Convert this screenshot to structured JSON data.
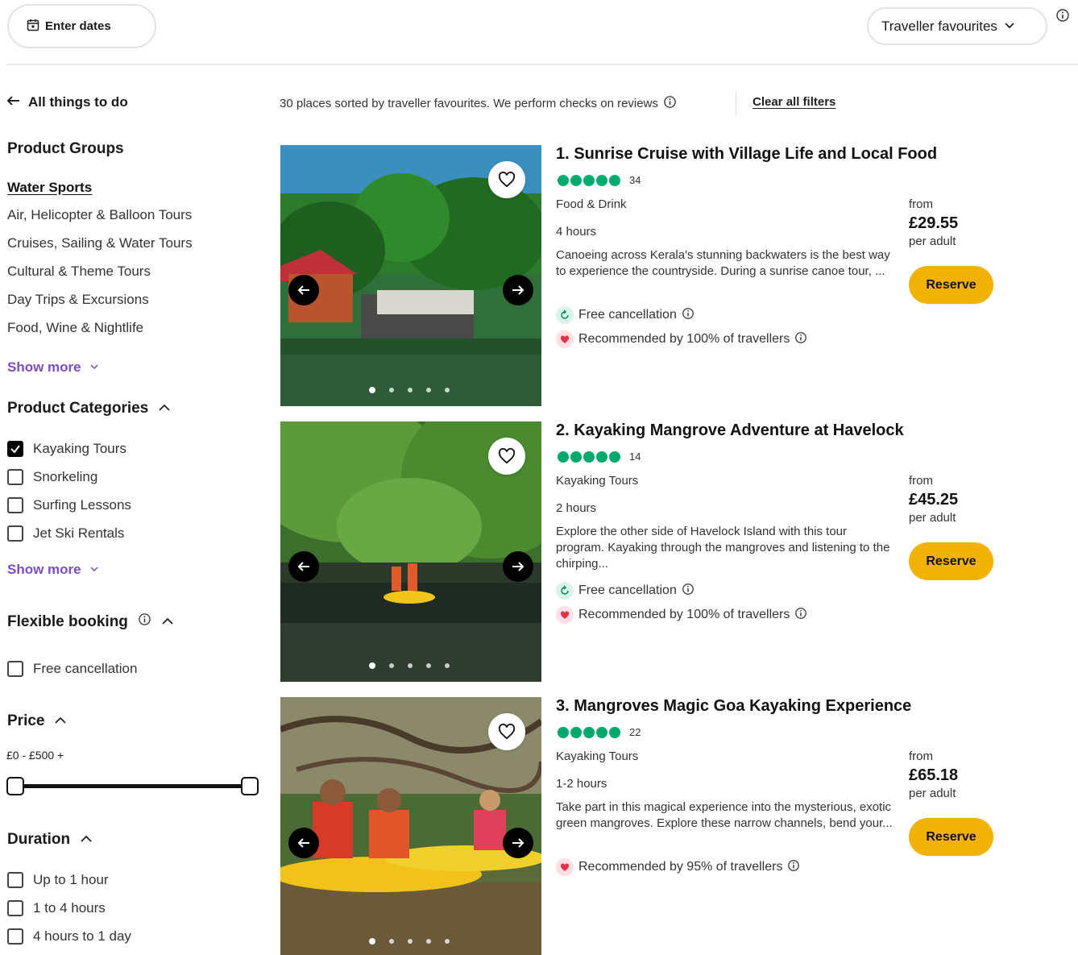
{
  "toolbar": {
    "dates_label": "Enter dates",
    "sort_label": "Traveller favourites"
  },
  "sidebar": {
    "back_label": "All things to do",
    "product_groups": {
      "heading": "Product Groups",
      "items": [
        {
          "label": "Water Sports",
          "active": true
        },
        {
          "label": "Air, Helicopter & Balloon Tours"
        },
        {
          "label": "Cruises, Sailing & Water Tours"
        },
        {
          "label": "Cultural & Theme Tours"
        },
        {
          "label": "Day Trips & Excursions"
        },
        {
          "label": "Food, Wine & Nightlife"
        }
      ],
      "show_more": "Show more"
    },
    "product_categories": {
      "heading": "Product Categories",
      "items": [
        {
          "label": "Kayaking Tours",
          "checked": true
        },
        {
          "label": "Snorkeling",
          "checked": false
        },
        {
          "label": "Surfing Lessons",
          "checked": false
        },
        {
          "label": "Jet Ski Rentals",
          "checked": false
        }
      ],
      "show_more": "Show more"
    },
    "flexible_booking": {
      "heading": "Flexible booking",
      "items": [
        {
          "label": "Free cancellation",
          "checked": false
        }
      ]
    },
    "price": {
      "heading": "Price",
      "range": "£0 - £500 +"
    },
    "duration": {
      "heading": "Duration",
      "items": [
        {
          "label": "Up to 1 hour",
          "checked": false
        },
        {
          "label": "1 to 4 hours",
          "checked": false
        },
        {
          "label": "4 hours to 1 day",
          "checked": false
        }
      ]
    }
  },
  "results": {
    "summary": "30 places sorted by traveller favourites. We perform checks on reviews",
    "clear_filters": "Clear all filters",
    "cards": [
      {
        "title": "1. Sunrise Cruise with Village Life and Local Food",
        "rating_count": "34",
        "rating_bubbles": 5,
        "category": "Food & Drink",
        "duration": "4 hours",
        "description": "Canoeing across Kerala's stunning backwaters is the best way to experience the countryside. During a sunrise canoe tour, ...",
        "free_cancellation": "Free cancellation",
        "recommended": "Recommended by 100% of travellers",
        "from": "from",
        "price": "£29.55",
        "per": "per adult",
        "reserve": "Reserve"
      },
      {
        "title": "2. Kayaking Mangrove Adventure at Havelock",
        "rating_count": "14",
        "rating_bubbles": 5,
        "category": "Kayaking Tours",
        "duration": "2 hours",
        "description": "Explore the other side of Havelock Island with this tour program. Kayaking through the mangroves and listening to the chirping...",
        "free_cancellation": "Free cancellation",
        "recommended": "Recommended by 100% of travellers",
        "from": "from",
        "price": "£45.25",
        "per": "per adult",
        "reserve": "Reserve"
      },
      {
        "title": "3. Mangroves Magic Goa Kayaking Experience",
        "rating_count": "22",
        "rating_bubbles": 5,
        "category": "Kayaking Tours",
        "duration": "1-2 hours",
        "description": "Take part in this magical experience into the mysterious, exotic green mangroves. Explore these narrow channels, bend your...",
        "recommended": "Recommended by 95% of travellers",
        "from": "from",
        "price": "£65.18",
        "per": "per adult",
        "reserve": "Reserve"
      }
    ]
  },
  "icons": {
    "calendar": "calendar-icon",
    "chevron_down": "chevron-down-icon",
    "chevron_up": "chevron-up-icon",
    "info": "info-icon",
    "back_arrow": "arrow-left-icon",
    "heart": "heart-icon",
    "prev": "arrow-left-icon",
    "next": "arrow-right-icon",
    "check": "checkmark-icon",
    "cancellation": "refresh-icon",
    "recommended": "heart-icon"
  },
  "colors": {
    "accent_purple": "#7c4dbf",
    "rating_green": "#00aa6c",
    "reserve_yellow": "#f2b203"
  }
}
